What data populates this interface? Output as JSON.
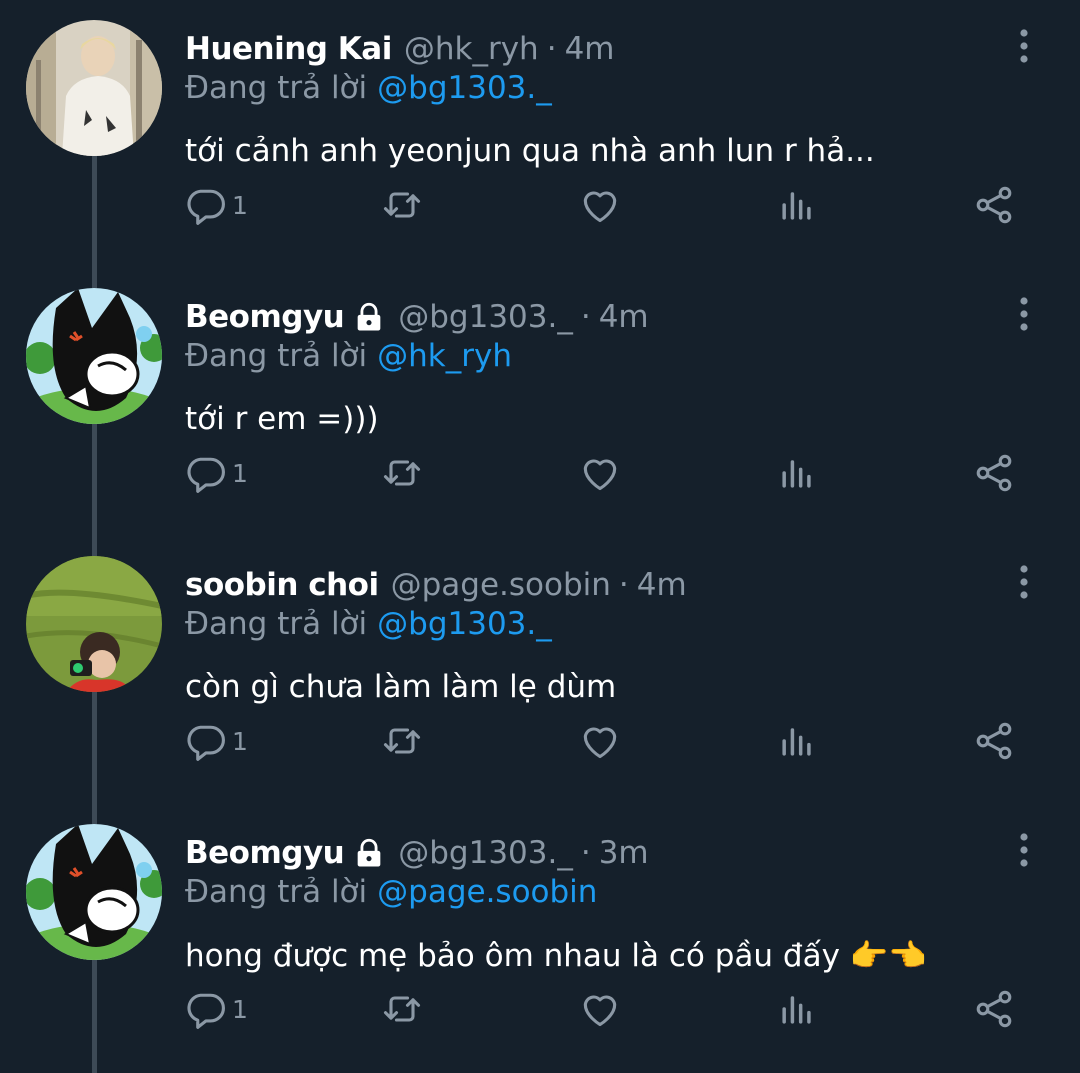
{
  "tweets": [
    {
      "display_name": "Huening Kai",
      "locked": false,
      "handle": "@hk_ryh",
      "separator": "·",
      "time": "4m",
      "reply_label": "Đang trả lời",
      "reply_to": "@bg1303._",
      "text": "tới cảnh anh yeonjun qua nhà anh lun r hả...",
      "reply_count": "1"
    },
    {
      "display_name": "Beomgyu",
      "locked": true,
      "handle": "@bg1303._",
      "separator": "·",
      "time": "4m",
      "reply_label": "Đang trả lời",
      "reply_to": "@hk_ryh",
      "text": "tới r em =)))",
      "reply_count": "1"
    },
    {
      "display_name": "soobin choi",
      "locked": false,
      "handle": "@page.soobin",
      "separator": "·",
      "time": "4m",
      "reply_label": "Đang trả lời",
      "reply_to": "@bg1303._",
      "text": "còn gì chưa làm làm lẹ dùm",
      "reply_count": "1"
    },
    {
      "display_name": "Beomgyu",
      "locked": true,
      "handle": "@bg1303._",
      "separator": "·",
      "time": "3m",
      "reply_label": "Đang trả lời",
      "reply_to": "@page.soobin",
      "text": "hong được mẹ bảo ôm nhau là có pầu đấy 👉👈",
      "reply_count": "1"
    }
  ],
  "icons": {
    "reply": "reply-icon",
    "retweet": "retweet-icon",
    "like": "heart-icon",
    "views": "views-icon",
    "share": "share-icon",
    "more": "more-vertical-icon",
    "lock": "lock-icon"
  },
  "colors": {
    "background": "#15202b",
    "text": "#ffffff",
    "muted": "#8b98a5",
    "link": "#1d9bf0",
    "thread_line": "#3d4a56"
  }
}
